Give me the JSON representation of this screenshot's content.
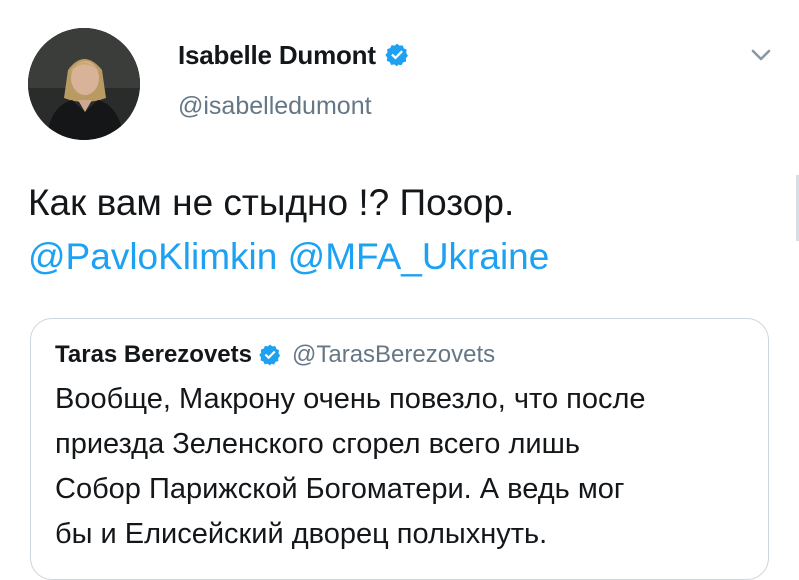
{
  "tweet": {
    "author": {
      "display_name": "Isabelle Dumont",
      "handle": "@isabelledumont",
      "verified": true,
      "avatar_icon": "profile-photo"
    },
    "menu_icon": "chevron-down-icon",
    "text_line_1": "Как вам не стыдно !?  Позор.",
    "mentions": [
      "@PavloKlimkin",
      "@MFA_Ukraine"
    ]
  },
  "quoted_tweet": {
    "display_name": "Taras Berezovets",
    "handle": "@TarasBerezovets",
    "verified": true,
    "lines": [
      "Вообще, Макрону очень повезло, что после",
      "приезда Зеленского сгорел всего лишь",
      "Собор Парижской Богоматери. А ведь мог",
      "бы и Елисейский дворец полыхнуть."
    ]
  },
  "colors": {
    "link": "#1da1f2",
    "verified_badge": "#1da1f2",
    "secondary_text": "#657786",
    "border": "#ccd6dd"
  }
}
